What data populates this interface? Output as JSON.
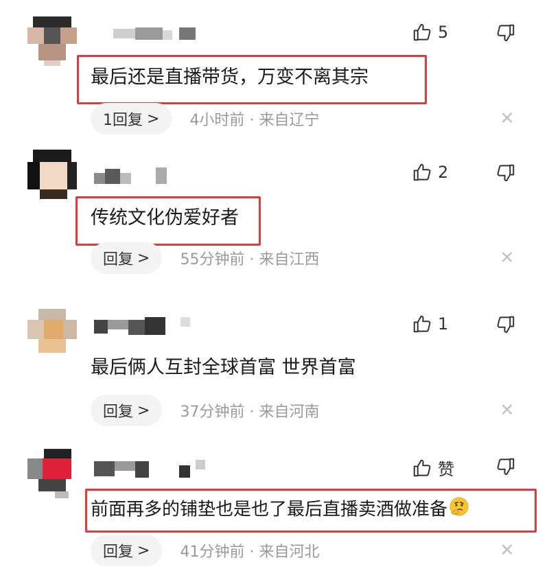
{
  "comments": [
    {
      "text": "最后还是直播带货，万变不离其宗",
      "likes": "5",
      "reply_label": "1回复",
      "time": "4小时前",
      "location": "来自辽宁",
      "highlighted": true
    },
    {
      "text": "传统文化伪爱好者",
      "likes": "2",
      "reply_label": "回复",
      "time": "55分钟前",
      "location": "来自江西",
      "highlighted": true
    },
    {
      "text": "最后俩人互封全球首富 世界首富",
      "likes": "1",
      "reply_label": "回复",
      "time": "37分钟前",
      "location": "来自河南",
      "highlighted": false
    },
    {
      "text": "前面再多的铺垫也是也了最后直播卖酒做准备",
      "likes": "赞",
      "reply_label": "回复",
      "time": "41分钟前",
      "location": "来自河北",
      "highlighted": true
    }
  ],
  "ui": {
    "chevron": ">",
    "separator": "·",
    "close_glyph": "✕"
  },
  "colors": {
    "highlight_border": "#e23a3a",
    "meta_text": "#999999",
    "reply_pill_bg": "#f3f3f3"
  },
  "icons": {
    "like": "thumbs-up-icon",
    "dislike": "thumbs-down-icon",
    "close": "close-icon",
    "emoji": "thinking-face-emoji"
  }
}
